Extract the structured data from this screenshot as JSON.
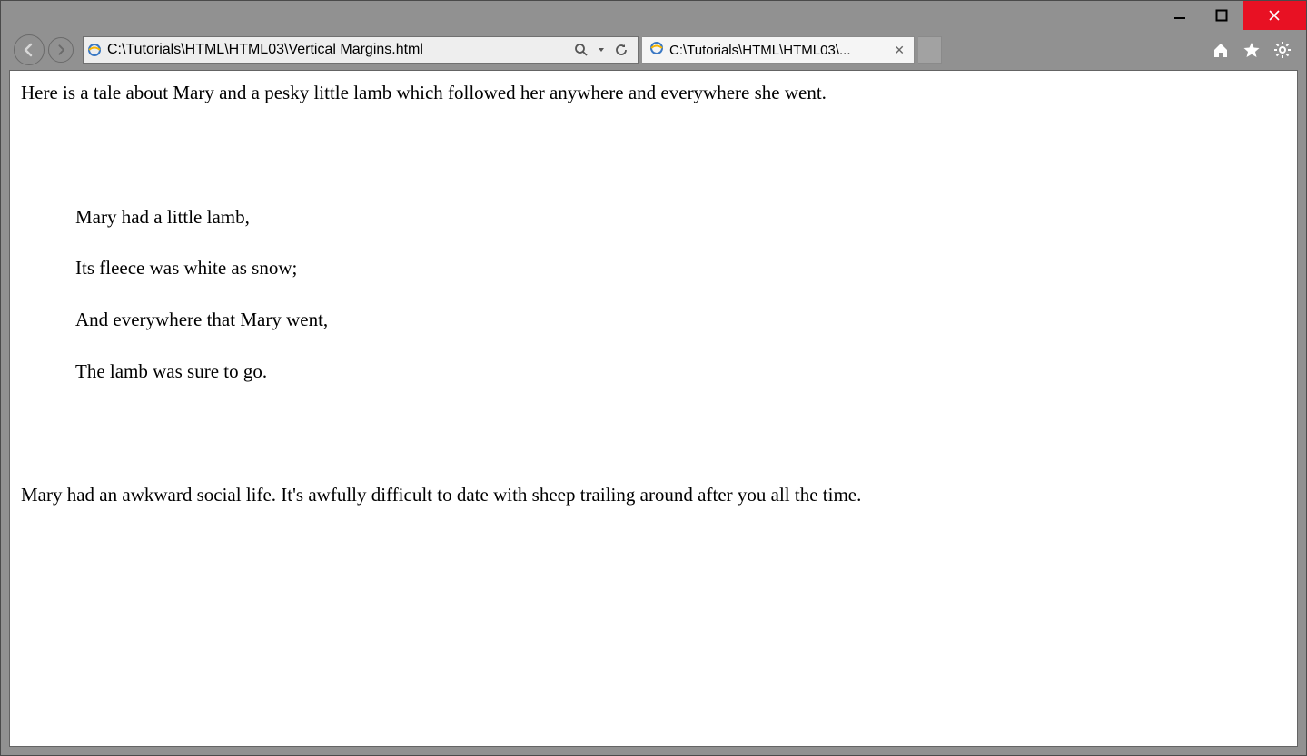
{
  "address_bar": {
    "url": "C:\\Tutorials\\HTML\\HTML03\\Vertical Margins.html"
  },
  "tab": {
    "title": "C:\\Tutorials\\HTML\\HTML03\\..."
  },
  "page": {
    "intro": "Here is a tale about Mary and a pesky little lamb which followed her anywhere and everywhere she went.",
    "poem_line1": "Mary had a little lamb,",
    "poem_line2": "Its fleece was white as snow;",
    "poem_line3": "And everywhere that Mary went,",
    "poem_line4": "The lamb was sure to go.",
    "outro": "Mary had an awkward social life. It's awfully difficult to date with sheep trailing around after you all the time."
  }
}
